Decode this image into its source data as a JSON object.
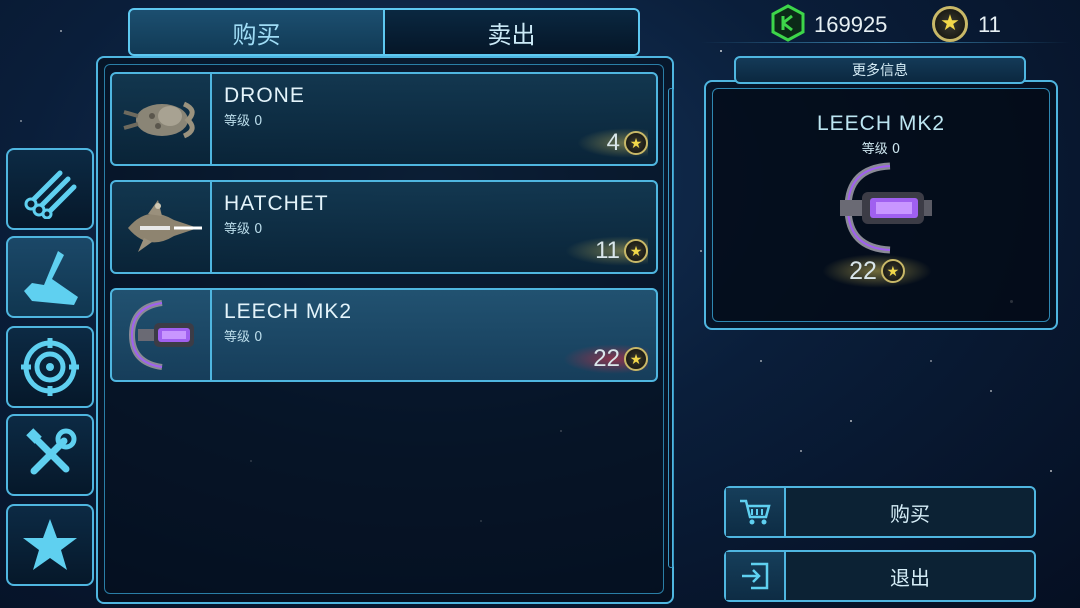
{
  "tabs": {
    "buy_label": "购买",
    "sell_label": "卖出",
    "active": "buy"
  },
  "currency": {
    "credits": "169925",
    "stars": "11",
    "credits_icon": "green-cube-icon",
    "stars_icon": "star-coin-icon"
  },
  "categories": [
    {
      "name": "weapons-pipes",
      "icon": "pipes-icon"
    },
    {
      "name": "ships",
      "icon": "leech-ship-icon",
      "active": true
    },
    {
      "name": "targeting",
      "icon": "crosshair-icon"
    },
    {
      "name": "upgrades",
      "icon": "tools-icon"
    },
    {
      "name": "favorites",
      "icon": "star-icon"
    }
  ],
  "ships": [
    {
      "name": "DRONE",
      "level": "等级 0",
      "price": "4",
      "thumb": "drone-ship"
    },
    {
      "name": "HATCHET",
      "level": "等级 0",
      "price": "11",
      "thumb": "hatchet-ship"
    },
    {
      "name": "LEECH MK2",
      "level": "等级 0",
      "price": "22",
      "thumb": "leech-ship",
      "selected": true,
      "unaffordable": true
    }
  ],
  "info": {
    "more_info_label": "更多信息",
    "name": "LEECH MK2",
    "level": "等级 0",
    "price": "22"
  },
  "actions": {
    "buy_label": "购买",
    "exit_label": "退出"
  },
  "colors": {
    "accent": "#4fb6e0",
    "price_gold": "#f2d84a",
    "unaffordable_glow": "#e6283c",
    "credits": "#3dd64a",
    "leech_purple": "#a060f0"
  }
}
